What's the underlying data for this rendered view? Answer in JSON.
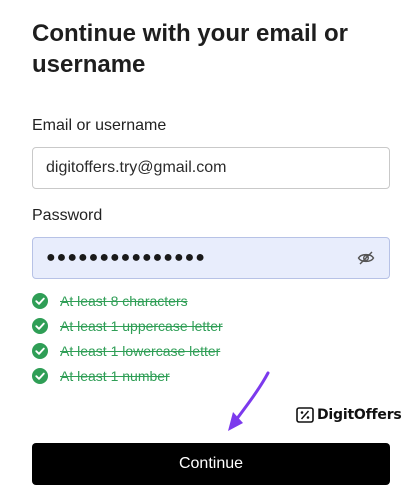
{
  "title": "Continue with your email or username",
  "email": {
    "label": "Email or username",
    "value": "digitoffers.try@gmail.com"
  },
  "password": {
    "label": "Password",
    "value": "●●●●●●●●●●●●●●●"
  },
  "rules": [
    "At least 8 characters",
    "At least 1 uppercase letter",
    "At least 1 lowercase letter",
    "At least 1 number"
  ],
  "watermark": {
    "name": "DigitOffers"
  },
  "continue_label": "Continue",
  "colors": {
    "success": "#2f9e56",
    "arrow": "#7c3aed",
    "password_fill": "#e8edfc",
    "button": "#000000"
  },
  "icons": {
    "password_toggle": "eye-slash-icon",
    "rule_check": "check-circle-icon",
    "pointer_arrow": "arrow-pointer-icon"
  }
}
